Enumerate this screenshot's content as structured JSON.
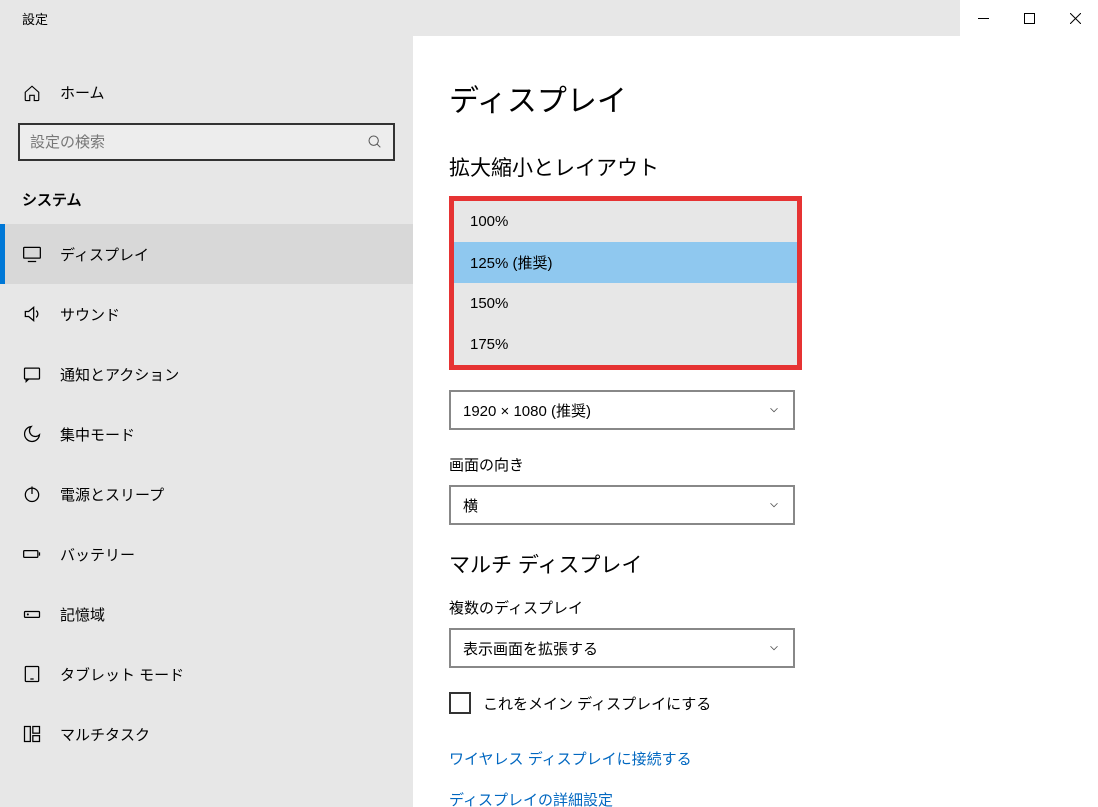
{
  "window": {
    "title": "設定"
  },
  "sidebar": {
    "home": "ホーム",
    "search_placeholder": "設定の検索",
    "category": "システム",
    "items": [
      {
        "label": "ディスプレイ",
        "icon": "monitor"
      },
      {
        "label": "サウンド",
        "icon": "speaker"
      },
      {
        "label": "通知とアクション",
        "icon": "notification"
      },
      {
        "label": "集中モード",
        "icon": "moon"
      },
      {
        "label": "電源とスリープ",
        "icon": "power"
      },
      {
        "label": "バッテリー",
        "icon": "battery"
      },
      {
        "label": "記憶域",
        "icon": "storage"
      },
      {
        "label": "タブレット モード",
        "icon": "tablet"
      },
      {
        "label": "マルチタスク",
        "icon": "multitask"
      }
    ]
  },
  "content": {
    "title": "ディスプレイ",
    "scale_section": "拡大縮小とレイアウト",
    "scale_options": [
      "100%",
      "125% (推奨)",
      "150%",
      "175%"
    ],
    "scale_selected_index": 1,
    "resolution_label": "",
    "resolution_value": "1920 × 1080 (推奨)",
    "orientation_label": "画面の向き",
    "orientation_value": "横",
    "multi_section": "マルチ ディスプレイ",
    "multi_label": "複数のディスプレイ",
    "multi_value": "表示画面を拡張する",
    "checkbox_label": "これをメイン ディスプレイにする",
    "link_wireless": "ワイヤレス ディスプレイに接続する",
    "link_advanced": "ディスプレイの詳細設定"
  }
}
